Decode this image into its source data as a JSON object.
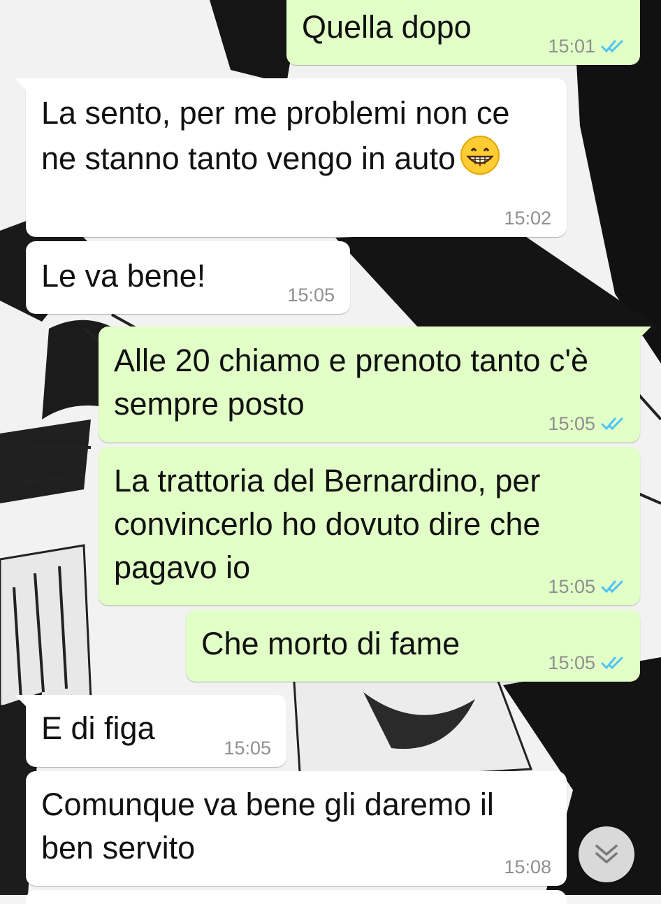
{
  "messages": [
    {
      "direction": "outgoing",
      "text": "Quella dopo",
      "time": "15:01",
      "status": "read"
    },
    {
      "direction": "incoming",
      "text": "La sento, per me problemi non ce ne stanno tanto vengo in auto",
      "emoji": "grinning-face-with-smiling-eyes",
      "time": "15:02"
    },
    {
      "direction": "incoming",
      "text": "Le va bene!",
      "time": "15:05"
    },
    {
      "direction": "outgoing",
      "text": "Alle 20 chiamo e prenoto tanto c'è sempre posto",
      "time": "15:05",
      "status": "read"
    },
    {
      "direction": "outgoing",
      "text": "La trattoria del Bernardino, per convincerlo ho dovuto dire che pagavo io",
      "time": "15:05",
      "status": "read"
    },
    {
      "direction": "outgoing",
      "text": "Che morto di fame",
      "time": "15:05",
      "status": "read"
    },
    {
      "direction": "incoming",
      "text": "E di figa",
      "time": "15:05"
    },
    {
      "direction": "incoming",
      "text": "Comunque va bene gli daremo il ben servito",
      "time": "15:08"
    }
  ],
  "colors": {
    "incoming_bubble": "#ffffff",
    "outgoing_bubble": "#e1ffc7",
    "read_tick": "#4fc3f7",
    "timestamp": "#8f8f8f"
  },
  "icons": {
    "read_receipt": "double-check-icon",
    "scroll_down": "chevron-down-double-icon"
  }
}
